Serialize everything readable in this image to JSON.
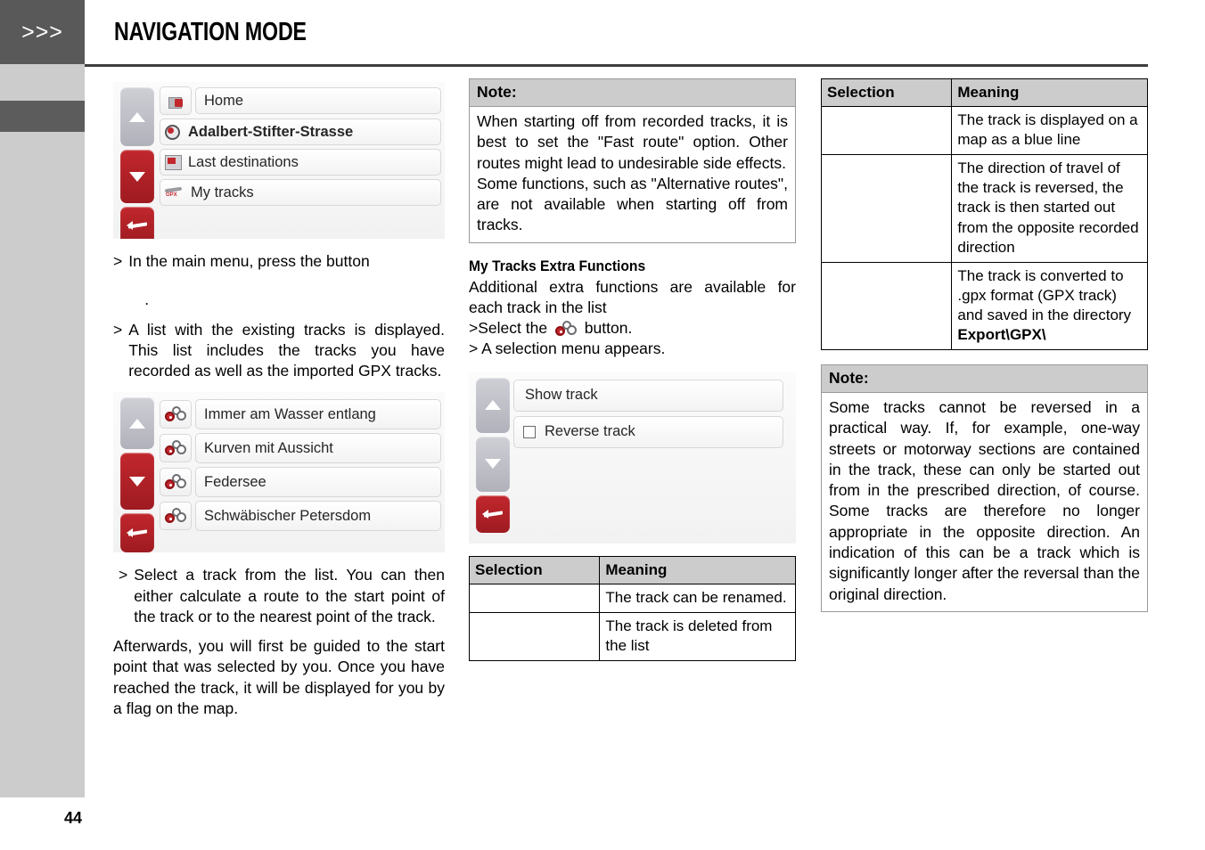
{
  "header": {
    "chevrons": ">>>",
    "title": "NAVIGATION MODE"
  },
  "page_number": "44",
  "column1": {
    "main_menu_screenshot": {
      "nav_buttons": [
        "scroll-up",
        "scroll-down",
        "back"
      ],
      "rows": [
        {
          "icon": "home-icon",
          "label": "Home",
          "bold": false
        },
        {
          "icon": "destination-pin-icon",
          "label": "Adalbert-Stifter-Strasse",
          "bold": true
        },
        {
          "icon": "last-destinations-icon",
          "label": "Last destinations",
          "bold": false
        },
        {
          "icon": "gpx-track-icon",
          "label": "My tracks",
          "bold": false
        }
      ]
    },
    "bullet1_marker": ">",
    "bullet1_text": "In the main menu, press the button",
    "bullet1_trailing": ".",
    "bullet2_marker": ">",
    "bullet2_text": "A list with the existing tracks is displayed. This list includes the tracks you have recorded as well as the imported GPX tracks.",
    "tracks_screenshot": {
      "rows": [
        {
          "icon": "gear-icon",
          "label": "Immer am Wasser entlang"
        },
        {
          "icon": "gear-icon",
          "label": "Kurven mit Aussicht"
        },
        {
          "icon": "gear-icon",
          "label": "Federsee"
        },
        {
          "icon": "gear-icon",
          "label": "Schwäbischer Petersdom"
        }
      ]
    },
    "bullet3_marker": ">",
    "bullet3_text": "Select a track from the list. You can then either calculate a route to the start point of the track or to the nearest point of the track.",
    "paragraph": "Afterwards, you will first be guided to the start point that was selected by you. Once you have reached the track, it will be displayed for you by a flag on the map."
  },
  "column2": {
    "note": {
      "heading": "Note:",
      "paragraph1": "When starting off from recorded tracks, it is best to set the \"Fast route\" option. Other routes might lead to undesirable side effects.",
      "paragraph2": "Some functions, such as \"Alternative routes\", are not available when starting off from tracks."
    },
    "subheading": "My Tracks Extra Functions",
    "intro": "Additional extra functions are available for each track in the list",
    "step1_prefix": ">Select the",
    "step1_suffix": "button.",
    "step2": "> A selection menu appears.",
    "menu_screenshot": {
      "rows": [
        {
          "label": "Show track",
          "checkbox": false
        },
        {
          "label": "Reverse track",
          "checkbox": true
        }
      ]
    },
    "table": {
      "headers": [
        "Selection",
        "Meaning"
      ],
      "rows": [
        {
          "selection": "",
          "meaning": "The track can be renamed."
        },
        {
          "selection": "",
          "meaning": "The track is deleted from the list"
        }
      ]
    }
  },
  "column3": {
    "table": {
      "headers": [
        "Selection",
        "Meaning"
      ],
      "rows": [
        {
          "selection": "",
          "meaning": "The track is displayed on a map as a blue line"
        },
        {
          "selection": "",
          "meaning": "The direction of travel of the track is reversed, the track is then started out from the opposite recorded direction"
        },
        {
          "selection": "",
          "meaning_plain": "The track is converted to .gpx format (GPX track) and saved in the directory ",
          "meaning_bold": "Export\\GPX\\"
        }
      ]
    },
    "note": {
      "heading": "Note:",
      "paragraph1": "Some tracks cannot be reversed in a practical way. If, for example, one-way streets or motorway sections are contained in the track, these can only be started out from in the prescribed direction, of course. Some tracks are therefore no longer appropriate in the opposite direction. An indication of this can be a track which is significantly longer after the reversal than the original direction."
    }
  },
  "colors": {
    "sidebar_dark": "#595959",
    "sidebar_light": "#cccccc",
    "accent_red": "#c1272d",
    "table_header": "#cccccc"
  }
}
